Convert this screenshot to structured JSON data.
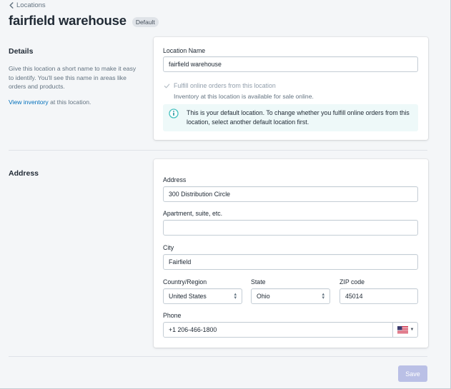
{
  "breadcrumb": {
    "label": "Locations"
  },
  "header": {
    "title": "fairfield warehouse",
    "badge": "Default"
  },
  "details": {
    "heading": "Details",
    "description": "Give this location a short name to make it easy to identify. You'll see this name in areas like orders and products.",
    "view_inventory_link": "View inventory",
    "view_inventory_suffix": " at this location.",
    "location_name_label": "Location Name",
    "location_name_value": "fairfield warehouse",
    "fulfill_label": "Fulfill online orders from this location",
    "fulfill_checked": true,
    "fulfill_help": "Inventory at this location is available for sale online.",
    "banner_text": "This is your default location. To change whether you fulfill online orders from this location, select another default location first."
  },
  "address": {
    "heading": "Address",
    "address_label": "Address",
    "address_value": "300 Distribution Circle",
    "apartment_label": "Apartment, suite, etc.",
    "apartment_value": "",
    "city_label": "City",
    "city_value": "Fairfield",
    "country_label": "Country/Region",
    "country_value": "United States",
    "state_label": "State",
    "state_value": "Ohio",
    "zip_label": "ZIP code",
    "zip_value": "45014",
    "phone_label": "Phone",
    "phone_value": "+1 206-466-1800",
    "phone_country_icon": "us-flag-icon"
  },
  "footer": {
    "save_label": "Save"
  },
  "colors": {
    "accent_link": "#006fbb",
    "banner_bg": "#eef9f9",
    "banner_icon": "#47c1bf",
    "save_disabled": "#bac0e6"
  }
}
